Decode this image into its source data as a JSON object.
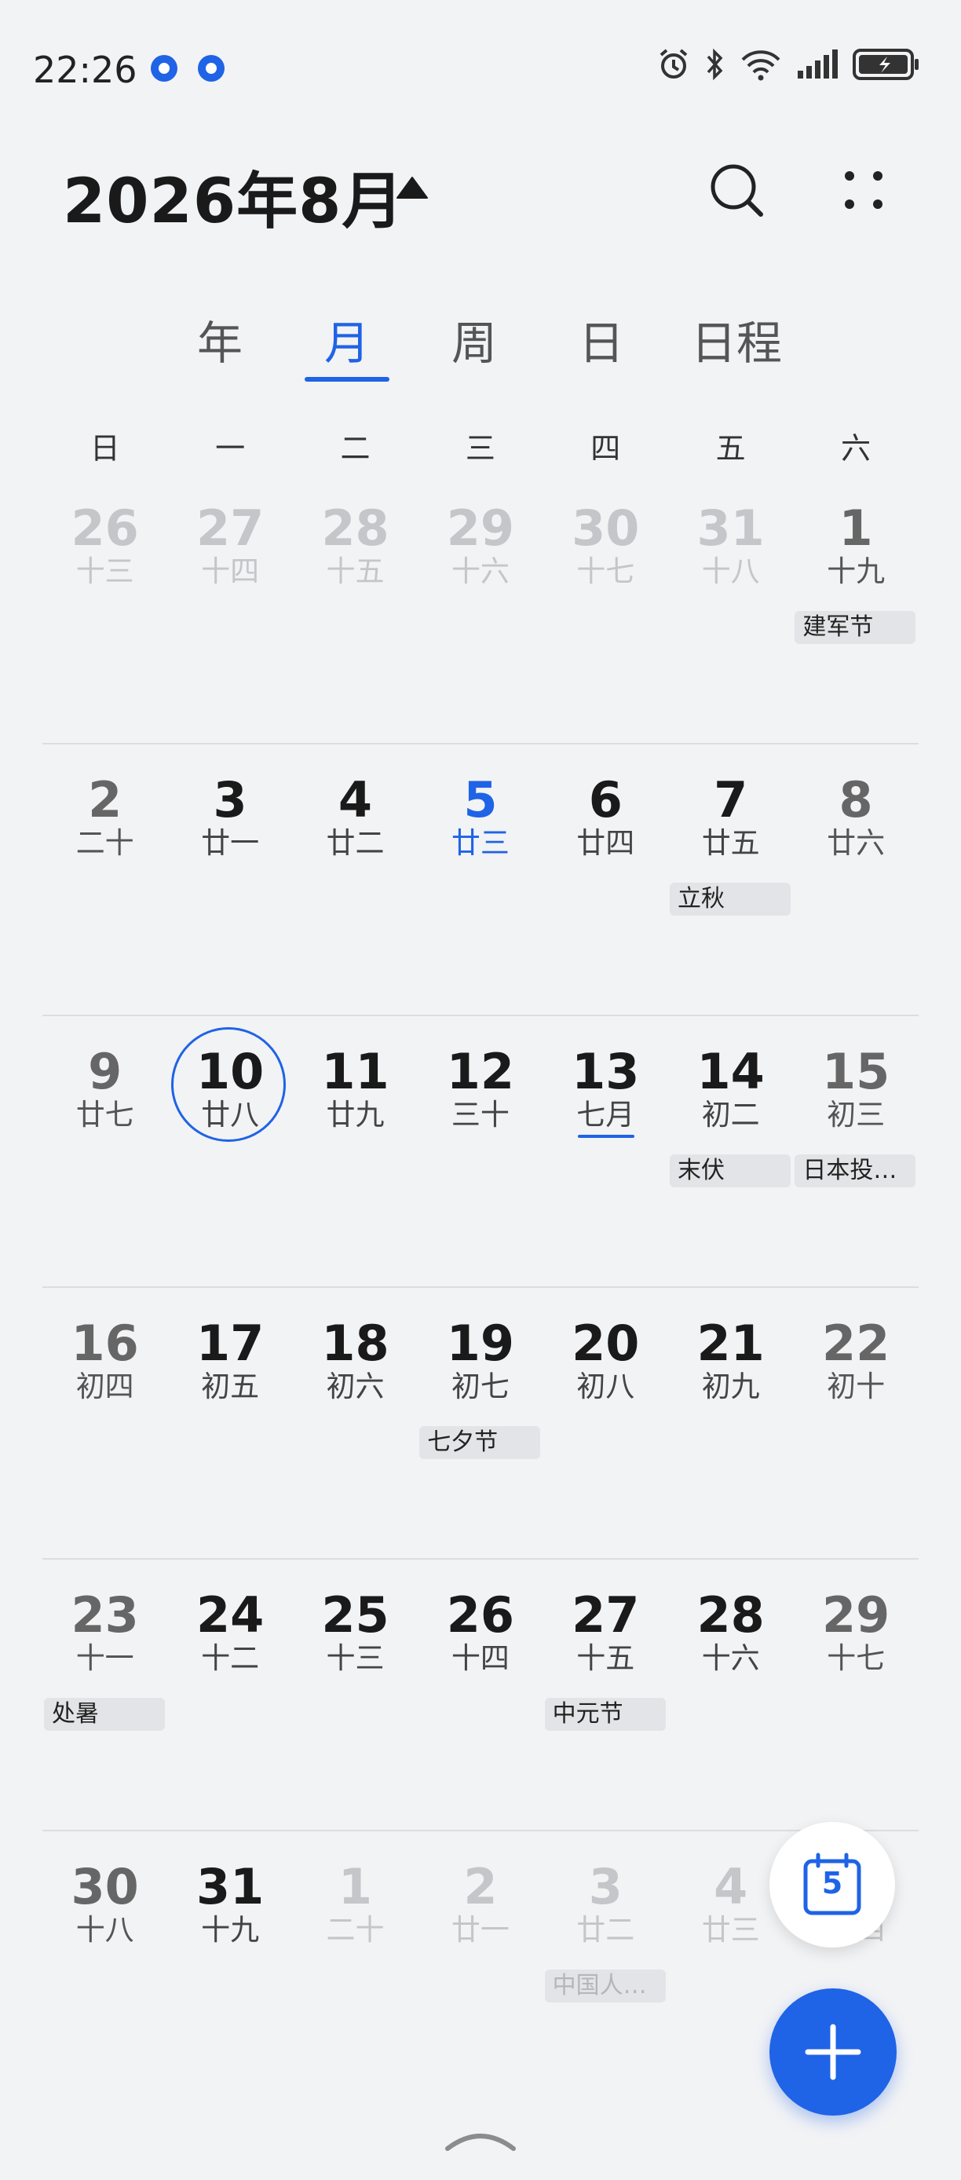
{
  "status": {
    "time": "22:26"
  },
  "header": {
    "title": "2026年8月"
  },
  "tabs": [
    {
      "label": "年"
    },
    {
      "label": "月"
    },
    {
      "label": "周"
    },
    {
      "label": "日"
    },
    {
      "label": "日程"
    }
  ],
  "active_tab": "月",
  "weekdays": [
    "日",
    "一",
    "二",
    "三",
    "四",
    "五",
    "六"
  ],
  "weeks": [
    [
      {
        "day": "26",
        "lunar": "十三",
        "muted": true
      },
      {
        "day": "27",
        "lunar": "十四",
        "muted": true
      },
      {
        "day": "28",
        "lunar": "十五",
        "muted": true
      },
      {
        "day": "29",
        "lunar": "十六",
        "muted": true
      },
      {
        "day": "30",
        "lunar": "十七",
        "muted": true
      },
      {
        "day": "31",
        "lunar": "十八",
        "muted": true
      },
      {
        "day": "1",
        "lunar": "十九",
        "event": "建军节"
      }
    ],
    [
      {
        "day": "2",
        "lunar": "二十"
      },
      {
        "day": "3",
        "lunar": "廿一"
      },
      {
        "day": "4",
        "lunar": "廿二"
      },
      {
        "day": "5",
        "lunar": "廿三",
        "today": true
      },
      {
        "day": "6",
        "lunar": "廿四"
      },
      {
        "day": "7",
        "lunar": "廿五",
        "event": "立秋"
      },
      {
        "day": "8",
        "lunar": "廿六"
      }
    ],
    [
      {
        "day": "9",
        "lunar": "廿七"
      },
      {
        "day": "10",
        "lunar": "廿八",
        "selected": true
      },
      {
        "day": "11",
        "lunar": "廿九"
      },
      {
        "day": "12",
        "lunar": "三十"
      },
      {
        "day": "13",
        "lunar": "七月",
        "lunar_underline": true
      },
      {
        "day": "14",
        "lunar": "初二",
        "event": "末伏"
      },
      {
        "day": "15",
        "lunar": "初三",
        "event": "日本投…"
      }
    ],
    [
      {
        "day": "16",
        "lunar": "初四"
      },
      {
        "day": "17",
        "lunar": "初五"
      },
      {
        "day": "18",
        "lunar": "初六"
      },
      {
        "day": "19",
        "lunar": "初七",
        "event": "七夕节"
      },
      {
        "day": "20",
        "lunar": "初八"
      },
      {
        "day": "21",
        "lunar": "初九"
      },
      {
        "day": "22",
        "lunar": "初十"
      }
    ],
    [
      {
        "day": "23",
        "lunar": "十一",
        "event": "处暑"
      },
      {
        "day": "24",
        "lunar": "十二"
      },
      {
        "day": "25",
        "lunar": "十三"
      },
      {
        "day": "26",
        "lunar": "十四"
      },
      {
        "day": "27",
        "lunar": "十五",
        "event": "中元节"
      },
      {
        "day": "28",
        "lunar": "十六"
      },
      {
        "day": "29",
        "lunar": "十七"
      }
    ],
    [
      {
        "day": "30",
        "lunar": "十八"
      },
      {
        "day": "31",
        "lunar": "十九"
      },
      {
        "day": "1",
        "lunar": "二十",
        "muted": true
      },
      {
        "day": "2",
        "lunar": "廿一",
        "muted": true
      },
      {
        "day": "3",
        "lunar": "廿二",
        "muted": true,
        "event": "中国人…"
      },
      {
        "day": "4",
        "lunar": "廿三",
        "muted": true
      },
      {
        "day": "5",
        "lunar": "廿四",
        "muted": true
      }
    ]
  ],
  "fab": {
    "today_day": "5"
  },
  "colors": {
    "accent": "#1f63e6",
    "background": "#f2f3f5"
  }
}
